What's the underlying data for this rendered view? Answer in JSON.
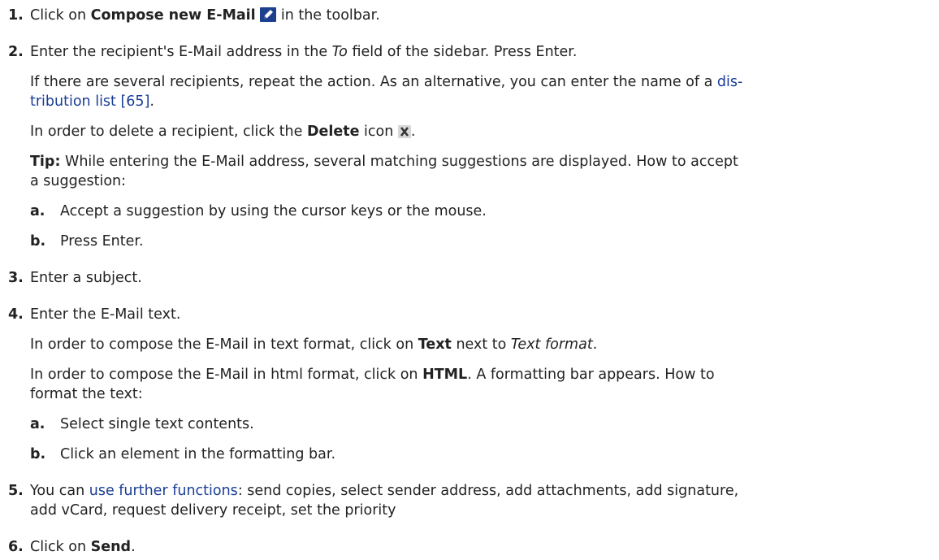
{
  "steps": {
    "s1": {
      "num": "1.",
      "a": "Click on ",
      "b": "Compose new E-Mail",
      "c": " in the toolbar.",
      "icon": "pencil-icon"
    },
    "s2": {
      "num": "2.",
      "l1a": "Enter the recipient's E-Mail address in the ",
      "l1b": "To",
      "l1c": " field of the sidebar. Press Enter.",
      "l2a": "If there are several recipients, repeat the action. As an alternative, you can enter the name of a ",
      "l2link": "dis-",
      "l3link": "tribution list [65]",
      "l3b": ".",
      "l4a": "In order to delete a recipient, click the ",
      "l4b": "Delete",
      "l4c": " icon ",
      "l4d": ".",
      "delete_icon": "delete-x-icon",
      "l5a": "Tip:",
      "l5b": " While entering the E-Mail address, several matching suggestions are displayed. How to accept",
      "l6": "a suggestion:",
      "sa_label": "a.",
      "sa_text": "Accept a suggestion by using the cursor keys or the mouse.",
      "sb_label": "b.",
      "sb_text": "Press Enter."
    },
    "s3": {
      "num": "3.",
      "text": "Enter a subject."
    },
    "s4": {
      "num": "4.",
      "l1": "Enter the E-Mail text.",
      "l2a": "In order to compose the E-Mail in text format, click on ",
      "l2b": "Text",
      "l2c": " next to ",
      "l2d": "Text format",
      "l2e": ".",
      "l3a": "In order to compose the E-Mail in html format, click on ",
      "l3b": "HTML",
      "l3c": ". A formatting bar appears. How to",
      "l4": "format the text:",
      "sa_label": "a.",
      "sa_text": "Select single text contents.",
      "sb_label": "b.",
      "sb_text": "Click an element in the formatting bar."
    },
    "s5": {
      "num": "5.",
      "l1a": "You can ",
      "l1link": "use further functions",
      "l1b": ": send copies, select sender address, add attachments, add signature,",
      "l2": "add vCard, request delivery receipt, set the priority"
    },
    "s6": {
      "num": "6.",
      "a": "Click on ",
      "b": "Send",
      "c": "."
    }
  }
}
